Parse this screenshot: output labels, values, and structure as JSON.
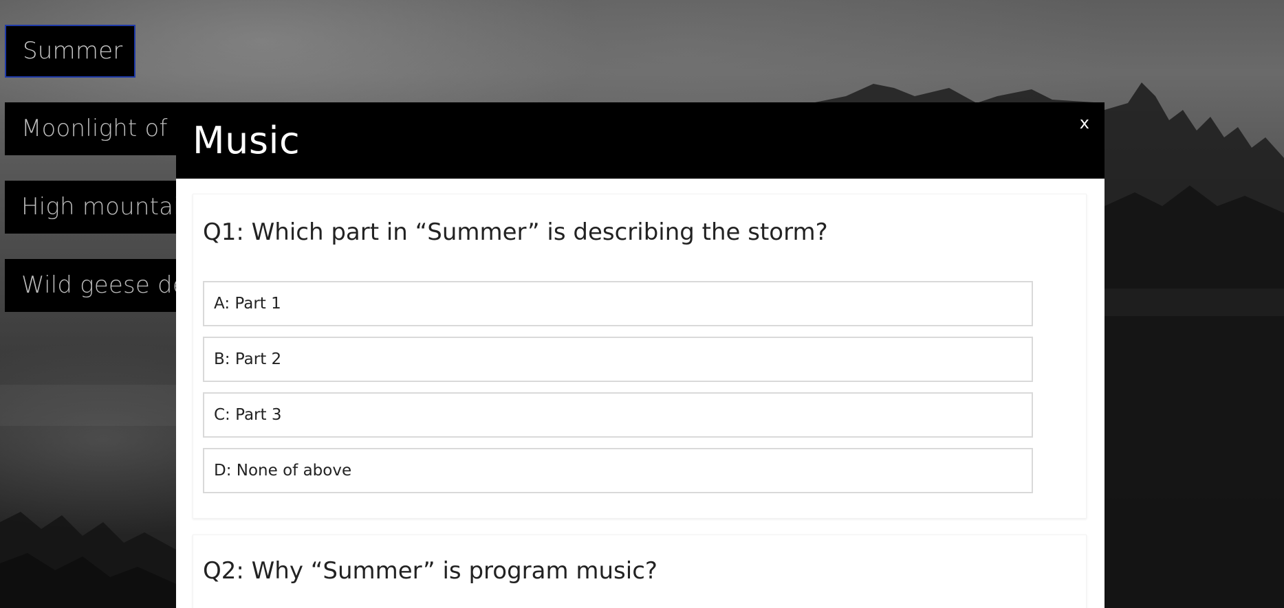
{
  "sidebar": {
    "items": [
      {
        "label": "Summer"
      },
      {
        "label": "Moonlight of the"
      },
      {
        "label": "High mountain"
      },
      {
        "label": "Wild geese de"
      }
    ]
  },
  "modal": {
    "title": "Music",
    "close_label": "x",
    "questions": [
      {
        "text": "Q1: Which part in “Summer” is describing the storm?",
        "options": [
          {
            "label": "A: Part 1"
          },
          {
            "label": "B: Part 2"
          },
          {
            "label": "C: Part 3"
          },
          {
            "label": "D: None of above"
          }
        ]
      },
      {
        "text": "Q2: Why “Summer” is program music?"
      }
    ]
  },
  "colors": {
    "active_border": "#1f3aa8",
    "button_bg": "#000000",
    "modal_header_bg": "#000000"
  }
}
